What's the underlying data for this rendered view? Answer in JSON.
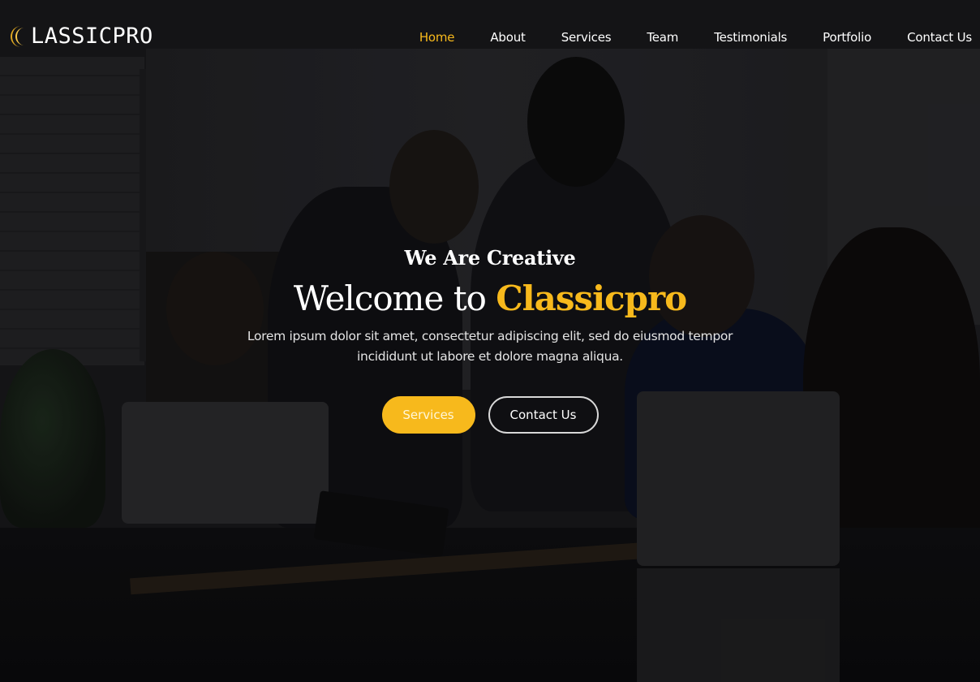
{
  "brand": {
    "logo_icon": "crescent-moon-icon",
    "logo_text": "LASSICPRO",
    "accent_color": "#f7b91c"
  },
  "nav": {
    "items": [
      {
        "label": "Home",
        "active": true
      },
      {
        "label": "About",
        "active": false
      },
      {
        "label": "Services",
        "active": false
      },
      {
        "label": "Team",
        "active": false
      },
      {
        "label": "Testimonials",
        "active": false
      },
      {
        "label": "Portfolio",
        "active": false
      },
      {
        "label": "Contact Us",
        "active": false
      }
    ]
  },
  "hero": {
    "subtitle": "We Are Creative",
    "title_prefix": "Welcome to ",
    "title_brand": "Classicpro",
    "description": "Lorem ipsum dolor sit amet, consectetur adipiscing elit, sed do eiusmod tempor incididunt ut labore et dolore magna aliqua.",
    "primary_button": "Services",
    "secondary_button": "Contact Us",
    "background": "office-team-meeting-photo"
  }
}
